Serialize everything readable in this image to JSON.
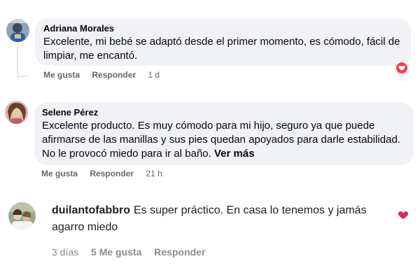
{
  "comments": [
    {
      "author": "Adriana Morales",
      "text": "Excelente, mi bebé se adaptó desde el primer momento, es cómodo, fácil de limpiar, me encantó.",
      "like_label": "Me gusta",
      "reply_label": "Responder",
      "time": "1 d",
      "reaction": "heart-icon"
    },
    {
      "author": "Selene Pérez",
      "text": "Excelente producto. Es muy cómodo para mi hijo, seguro ya que puede afirmarse de las manillas y sus pies quedan apoyados para darle estabilidad. No le provocó miedo para ir al baño.",
      "see_more": "Ver más",
      "like_label": "Me gusta",
      "reply_label": "Responder",
      "time": "21 h"
    },
    {
      "author": "duilantofabbro",
      "text": "Es super práctico. En casa lo tenemos y jamás agarro miedo",
      "time": "3 días",
      "likes_label": "5 Me gusta",
      "reply_label": "Responder",
      "reaction": "heart-icon"
    }
  ],
  "colors": {
    "bubble": "#f0f2f5",
    "meta": "#65676b",
    "heart": "#f33e58",
    "heart_app": "#e0245e"
  }
}
